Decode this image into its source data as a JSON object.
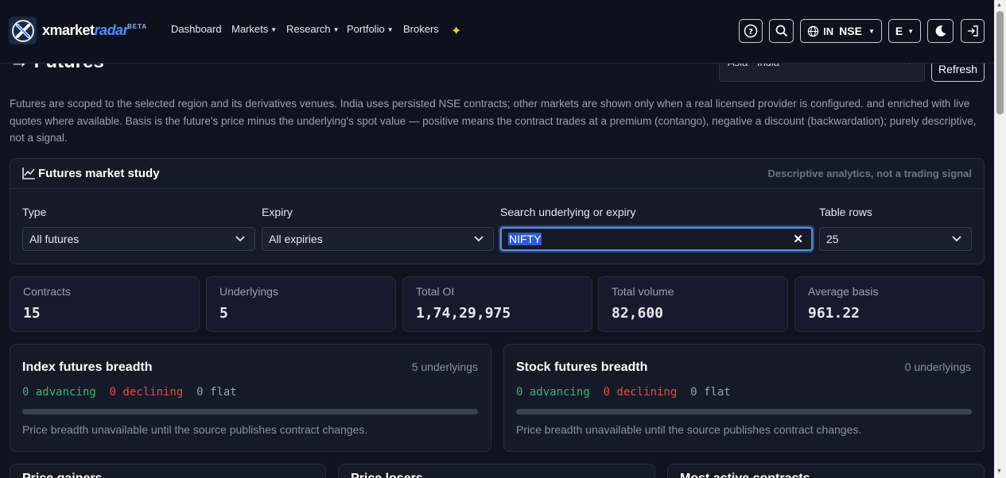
{
  "brand": {
    "name_a": "xmarket",
    "name_b": "radar",
    "badge": "BETA"
  },
  "nav": {
    "dashboard": "Dashboard",
    "markets": "Markets",
    "research": "Research",
    "portfolio": "Portfolio",
    "brokers": "Brokers"
  },
  "topbar": {
    "market_country": "IN",
    "market_exchange": "NSE",
    "lang": "E"
  },
  "page": {
    "title": "Futures",
    "region": "Asia · India",
    "refresh_label": "Refresh"
  },
  "description": "Futures are scoped to the selected region and its derivatives venues. India uses persisted NSE contracts; other markets are shown only when a real licensed provider is configured. and enriched with live quotes where available. Basis is the future's price minus the underlying's spot value — positive means the contract trades at a premium (contango), negative a discount (backwardation); purely descriptive, not a signal.",
  "study": {
    "title": "Futures market study",
    "note": "Descriptive analytics, not a trading signal",
    "type_label": "Type",
    "type_value": "All futures",
    "expiry_label": "Expiry",
    "expiry_value": "All expiries",
    "search_label": "Search underlying or expiry",
    "search_value": "NIFTY",
    "rows_label": "Table rows",
    "rows_value": "25"
  },
  "stats": [
    {
      "label": "Contracts",
      "value": "15"
    },
    {
      "label": "Underlyings",
      "value": "5"
    },
    {
      "label": "Total OI",
      "value": "1,74,29,975"
    },
    {
      "label": "Total volume",
      "value": "82,600"
    },
    {
      "label": "Average basis",
      "value": "961.22"
    }
  ],
  "breadth": [
    {
      "title": "Index futures breadth",
      "count": "5 underlyings",
      "advancing": "0 advancing",
      "declining": "0 declining",
      "flat": "0 flat",
      "note": "Price breadth unavailable until the source publishes contract changes."
    },
    {
      "title": "Stock futures breadth",
      "count": "0 underlyings",
      "advancing": "0 advancing",
      "declining": "0 declining",
      "flat": "0 flat",
      "note": "Price breadth unavailable until the source publishes contract changes."
    }
  ],
  "bottom_cards": [
    "Price gainers",
    "Price losers",
    "Most active contracts"
  ],
  "colors": {
    "accent": "#4c8dff",
    "advancing": "#3cb371",
    "declining": "#f04545",
    "background": "#0f1320"
  }
}
